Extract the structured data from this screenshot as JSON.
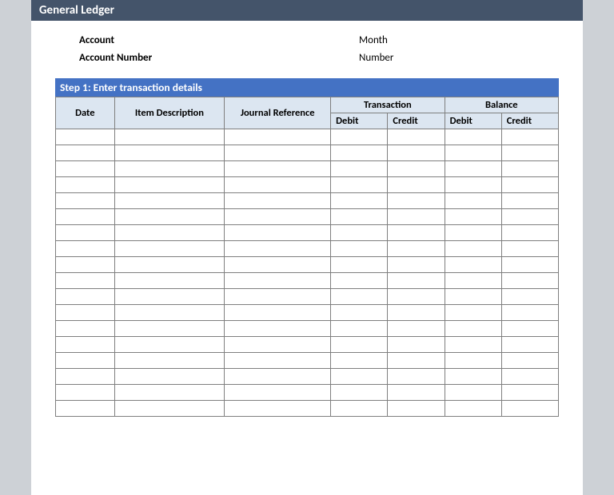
{
  "title": "General Ledger",
  "header": {
    "account_label": "Account",
    "account_number_label": "Account Number",
    "month_label": "Month",
    "number_label": "Number"
  },
  "step_title": "Step 1: Enter transaction details",
  "columns": {
    "date": "Date",
    "item_description": "Item Description",
    "journal_reference": "Journal Reference",
    "transaction_group": "Transaction",
    "balance_group": "Balance",
    "debit": "Debit",
    "credit": "Credit"
  },
  "rows": [
    {
      "date": "",
      "desc": "",
      "ref": "",
      "t_debit": "",
      "t_credit": "",
      "b_debit": "",
      "b_credit": ""
    },
    {
      "date": "",
      "desc": "",
      "ref": "",
      "t_debit": "",
      "t_credit": "",
      "b_debit": "",
      "b_credit": ""
    },
    {
      "date": "",
      "desc": "",
      "ref": "",
      "t_debit": "",
      "t_credit": "",
      "b_debit": "",
      "b_credit": ""
    },
    {
      "date": "",
      "desc": "",
      "ref": "",
      "t_debit": "",
      "t_credit": "",
      "b_debit": "",
      "b_credit": ""
    },
    {
      "date": "",
      "desc": "",
      "ref": "",
      "t_debit": "",
      "t_credit": "",
      "b_debit": "",
      "b_credit": ""
    },
    {
      "date": "",
      "desc": "",
      "ref": "",
      "t_debit": "",
      "t_credit": "",
      "b_debit": "",
      "b_credit": ""
    },
    {
      "date": "",
      "desc": "",
      "ref": "",
      "t_debit": "",
      "t_credit": "",
      "b_debit": "",
      "b_credit": ""
    },
    {
      "date": "",
      "desc": "",
      "ref": "",
      "t_debit": "",
      "t_credit": "",
      "b_debit": "",
      "b_credit": ""
    },
    {
      "date": "",
      "desc": "",
      "ref": "",
      "t_debit": "",
      "t_credit": "",
      "b_debit": "",
      "b_credit": ""
    },
    {
      "date": "",
      "desc": "",
      "ref": "",
      "t_debit": "",
      "t_credit": "",
      "b_debit": "",
      "b_credit": ""
    },
    {
      "date": "",
      "desc": "",
      "ref": "",
      "t_debit": "",
      "t_credit": "",
      "b_debit": "",
      "b_credit": ""
    },
    {
      "date": "",
      "desc": "",
      "ref": "",
      "t_debit": "",
      "t_credit": "",
      "b_debit": "",
      "b_credit": ""
    },
    {
      "date": "",
      "desc": "",
      "ref": "",
      "t_debit": "",
      "t_credit": "",
      "b_debit": "",
      "b_credit": ""
    },
    {
      "date": "",
      "desc": "",
      "ref": "",
      "t_debit": "",
      "t_credit": "",
      "b_debit": "",
      "b_credit": ""
    },
    {
      "date": "",
      "desc": "",
      "ref": "",
      "t_debit": "",
      "t_credit": "",
      "b_debit": "",
      "b_credit": ""
    },
    {
      "date": "",
      "desc": "",
      "ref": "",
      "t_debit": "",
      "t_credit": "",
      "b_debit": "",
      "b_credit": ""
    },
    {
      "date": "",
      "desc": "",
      "ref": "",
      "t_debit": "",
      "t_credit": "",
      "b_debit": "",
      "b_credit": ""
    },
    {
      "date": "",
      "desc": "",
      "ref": "",
      "t_debit": "",
      "t_credit": "",
      "b_debit": "",
      "b_credit": ""
    }
  ]
}
